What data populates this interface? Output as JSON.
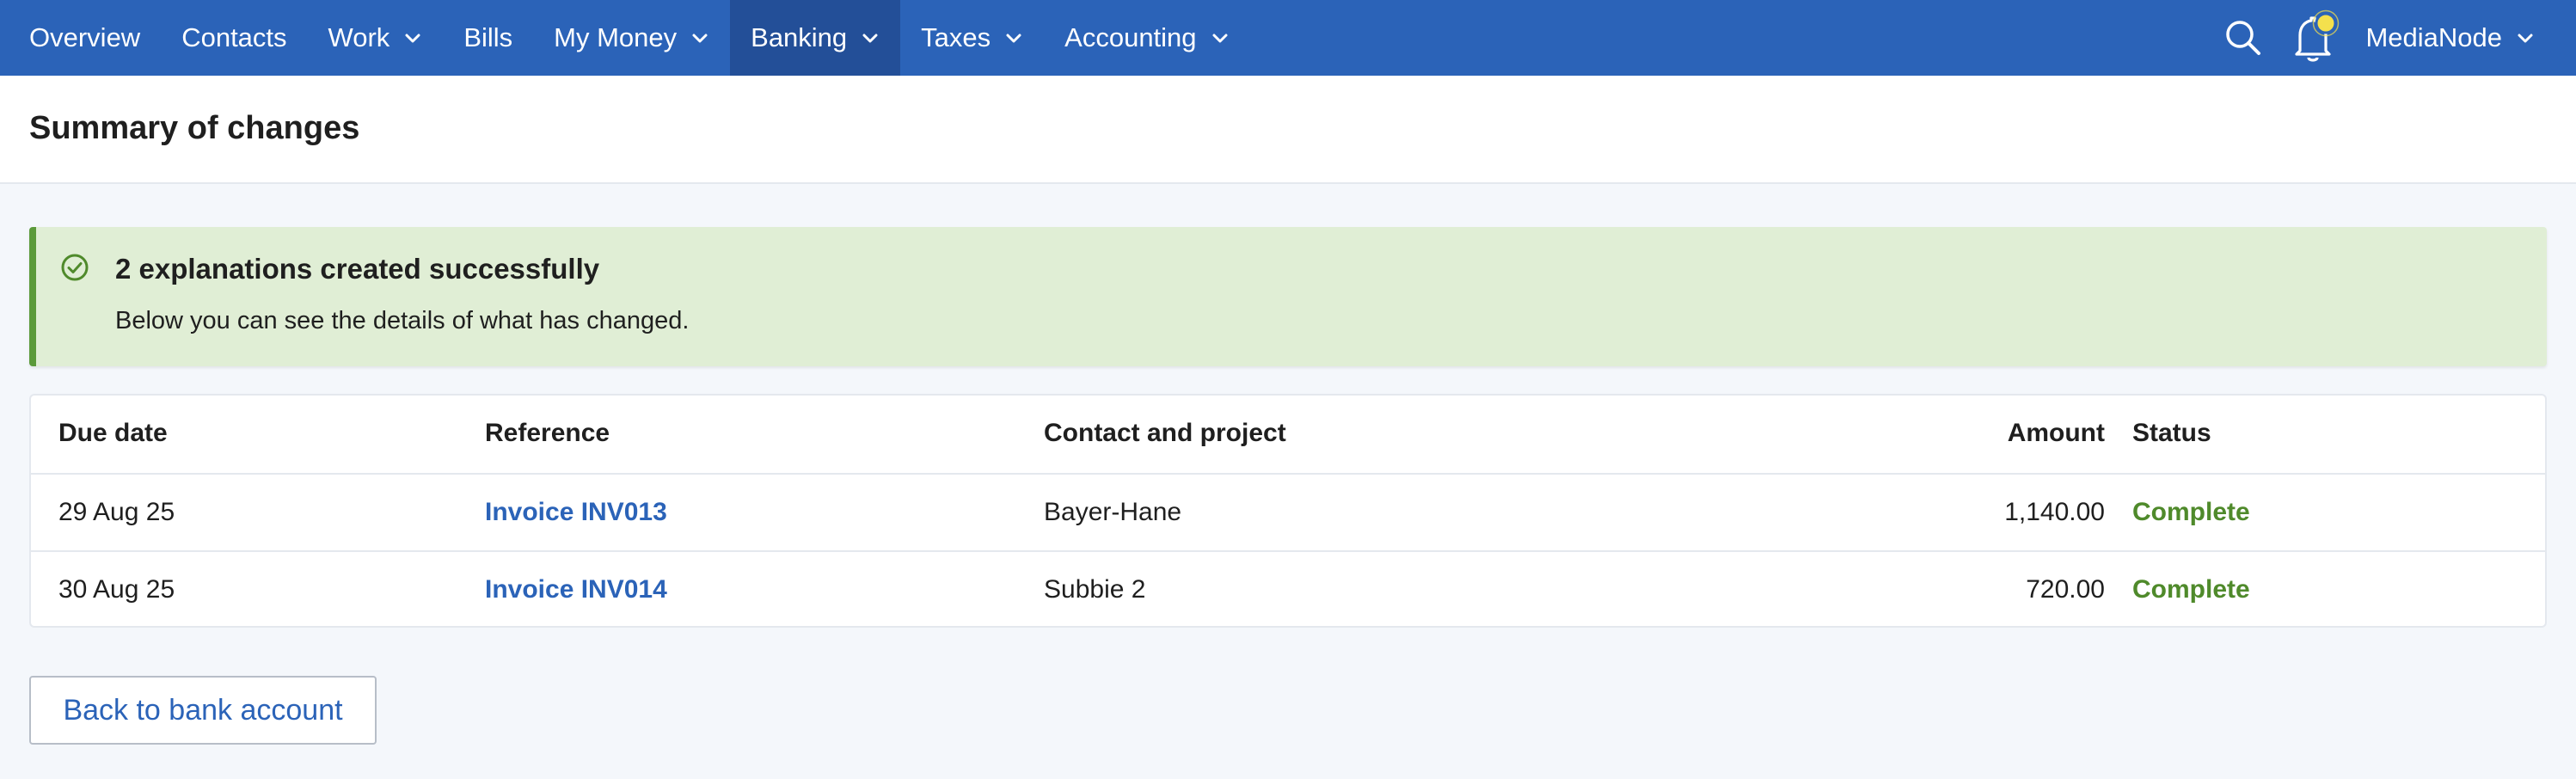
{
  "nav": {
    "items": [
      {
        "label": "Overview",
        "dropdown": false,
        "active": false
      },
      {
        "label": "Contacts",
        "dropdown": false,
        "active": false
      },
      {
        "label": "Work",
        "dropdown": true,
        "active": false
      },
      {
        "label": "Bills",
        "dropdown": false,
        "active": false
      },
      {
        "label": "My Money",
        "dropdown": true,
        "active": false
      },
      {
        "label": "Banking",
        "dropdown": true,
        "active": true
      },
      {
        "label": "Taxes",
        "dropdown": true,
        "active": false
      },
      {
        "label": "Accounting",
        "dropdown": true,
        "active": false
      }
    ],
    "account_label": "MediaNode",
    "icons": [
      "search-icon",
      "bell-icon",
      "chevron-down-icon"
    ]
  },
  "page": {
    "title": "Summary of changes"
  },
  "alert": {
    "title": "2 explanations created successfully",
    "body": "Below you can see the details of what has changed.",
    "icon": "check-circle-icon"
  },
  "table": {
    "headers": {
      "due_date": "Due date",
      "reference": "Reference",
      "contact": "Contact and project",
      "amount": "Amount",
      "status": "Status"
    },
    "rows": [
      {
        "due_date": "29 Aug 25",
        "reference": "Invoice INV013",
        "contact": "Bayer-Hane",
        "amount": "1,140.00",
        "status": "Complete"
      },
      {
        "due_date": "30 Aug 25",
        "reference": "Invoice INV014",
        "contact": "Subbie 2",
        "amount": "720.00",
        "status": "Complete"
      }
    ]
  },
  "actions": {
    "back_label": "Back to bank account"
  },
  "colors": {
    "nav_bg": "#2b63b8",
    "nav_active_bg": "#234f98",
    "success_bg": "#e0eed5",
    "success_accent": "#5b9a3a",
    "status_complete": "#4f8a2b",
    "link": "#2b63b8",
    "notification_dot": "#f4e04d"
  }
}
